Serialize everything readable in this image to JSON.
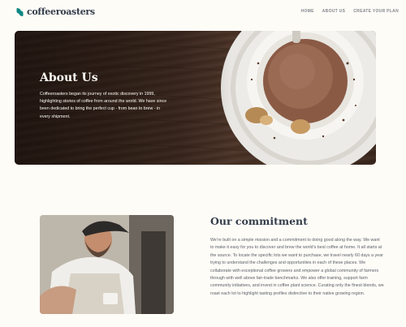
{
  "header": {
    "brand": "coffeeroasters",
    "logo_icon": "coffee-bean-logo-icon",
    "nav": [
      {
        "label": "HOME"
      },
      {
        "label": "ABOUT US"
      },
      {
        "label": "CREATE YOUR PLAN"
      }
    ]
  },
  "hero": {
    "title": "About Us",
    "text": "Coffeeroasters began its journey of exotic discovery in 1999, highlighting stories of coffee from around the world. We have since been dedicated to bring the perfect cup - from bean to brew - in every shipment.",
    "image": "cup-of-coffee-on-wooden-table-photo"
  },
  "commitment": {
    "title": "Our commitment",
    "text": "We’re built on a simple mission and a commitment to doing good along the way. We want to make it easy for you to discover and brew the world’s best coffee at home. It all starts at the source. To locate the specific lots we want to purchase, we travel nearly 60 days a year trying to understand the challenges and opportunities in each of these places. We collaborate with exceptional coffee growers and empower a global community of farmers through with well above fair-trade benchmarks. We also offer training, support farm community initiatives, and invest in coffee plant science. Curating only the finest blends, we roast each lot to highlight tasting profiles distinctive to their native growing region.",
    "image": "barista-pouring-coffee-photo"
  },
  "colors": {
    "background": "#FEFCF7",
    "dark_text": "#333D4B",
    "accent": "#0E8784"
  }
}
